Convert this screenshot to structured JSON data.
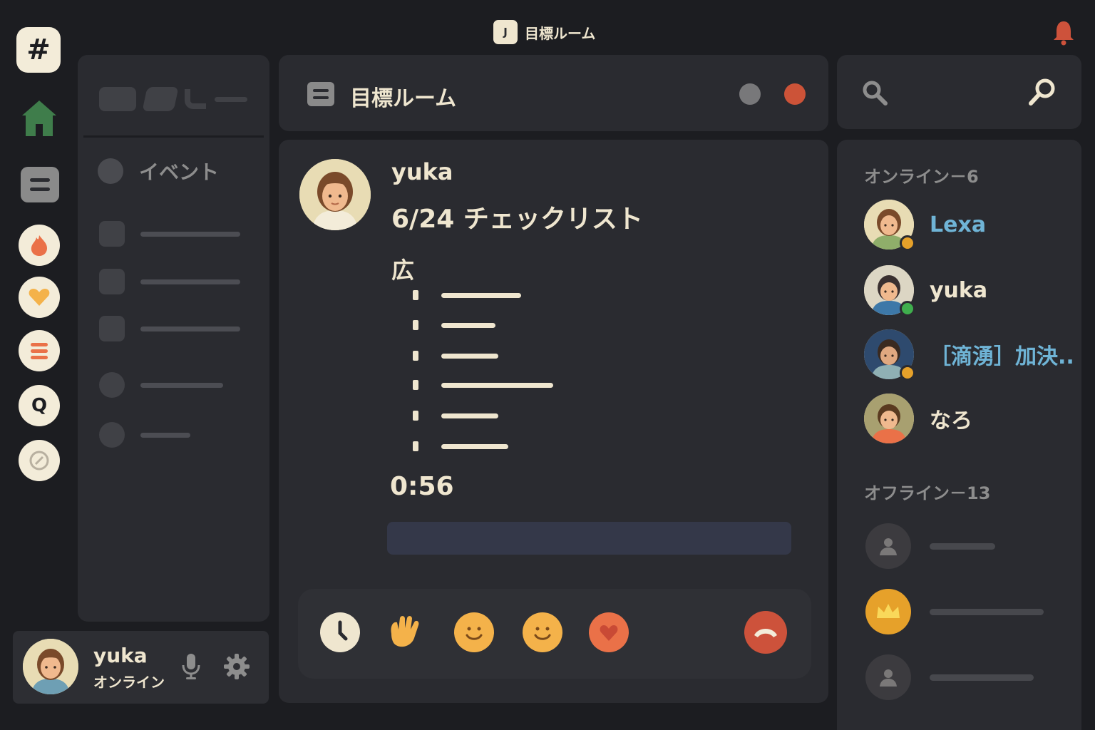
{
  "app": {
    "logo_letter": "J",
    "title": "目標ルーム"
  },
  "rail": {
    "hash_label": "#",
    "search_server_label": "Q"
  },
  "channels": {
    "event_label": "イベント"
  },
  "user_panel": {
    "name": "yuka",
    "status": "オンライン"
  },
  "room": {
    "title": "目標ルーム"
  },
  "message": {
    "author": "yuka",
    "title": "6/24 チェックリスト",
    "section": "広",
    "checklist_count": 6,
    "time": "0:56"
  },
  "reactions": {
    "items": [
      "clock-icon",
      "hand-icon",
      "smile-icon",
      "smile-icon",
      "heart-icon",
      "hang-up-icon"
    ]
  },
  "members": {
    "online_header": "オンライン－6",
    "offline_header": "オフライン－13",
    "online": [
      {
        "name": "Lexa",
        "status_color": "#e6a12a"
      },
      {
        "name": "yuka",
        "status_color": "#3fae4d"
      },
      {
        "name": "［滴湧］加決..",
        "status_color": "#e6a12a"
      },
      {
        "name": "なろ",
        "status_color": ""
      }
    ]
  },
  "colors": {
    "background": "#1c1d21",
    "panel": "#2a2b30",
    "text": "#efe6cf",
    "accent_red": "#cd523b",
    "accent_blue_name": "#6fb4d6",
    "status_online": "#3fae4d",
    "status_idle": "#e6a12a"
  }
}
